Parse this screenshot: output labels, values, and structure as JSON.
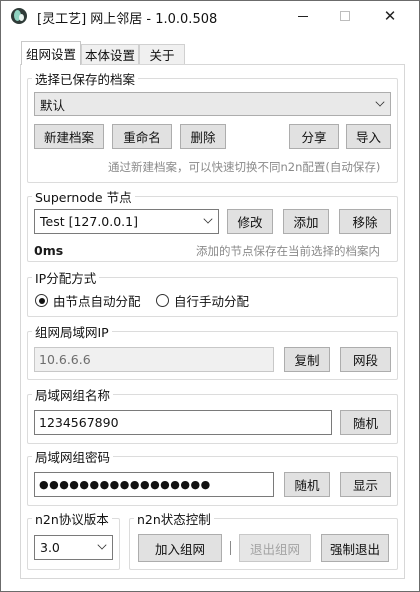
{
  "window": {
    "title": "[灵工艺] 网上邻居 - 1.0.0.508"
  },
  "tabs": [
    "组网设置",
    "本体设置",
    "关于"
  ],
  "profile": {
    "group_title": "选择已保存的档案",
    "selected": "默认",
    "buttons": {
      "new": "新建档案",
      "rename": "重命名",
      "delete": "删除",
      "share": "分享",
      "import": "导入"
    },
    "hint": "通过新建档案，可以快速切换不同n2n配置(自动保存)"
  },
  "supernode": {
    "group_title": "Supernode 节点",
    "selected": "Test [127.0.0.1]",
    "buttons": {
      "modify": "修改",
      "add": "添加",
      "remove": "移除"
    },
    "latency": "0ms",
    "hint": "添加的节点保存在当前选择的档案内"
  },
  "ip_mode": {
    "group_title": "IP分配方式",
    "options": [
      "由节点自动分配",
      "自行手动分配"
    ],
    "selected_index": 0
  },
  "lan_ip": {
    "group_title": "组网局域网IP",
    "value": "10.6.6.6",
    "buttons": {
      "copy": "复制",
      "segment": "网段"
    }
  },
  "group_name": {
    "group_title": "局域网组名称",
    "value": "1234567890",
    "buttons": {
      "random": "随机"
    }
  },
  "group_password": {
    "group_title": "局域网组密码",
    "value": "●●●●●●●●●●●●●●●●●",
    "buttons": {
      "random": "随机",
      "show": "显示"
    }
  },
  "protocol": {
    "group_title": "n2n协议版本",
    "selected": "3.0"
  },
  "control": {
    "group_title": "n2n状态控制",
    "buttons": {
      "join": "加入组网",
      "exit": "退出组网",
      "force_exit": "强制退出"
    }
  }
}
